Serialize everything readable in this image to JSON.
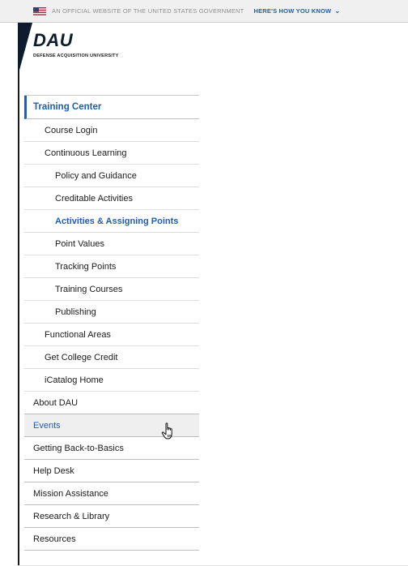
{
  "banner": {
    "official_text": "AN OFFICIAL WEBSITE OF THE UNITED STATES GOVERNMENT",
    "how_label": "HERE'S HOW YOU KNOW",
    "chevron": "⌄"
  },
  "logo": {
    "mark": "DAU",
    "subtitle": "DEFENSE ACQUISITION UNIVERSITY"
  },
  "nav": {
    "training_center": "Training Center",
    "course_login": "Course Login",
    "continuous_learning": "Continuous Learning",
    "policy_guidance": "Policy and Guidance",
    "creditable_activities": "Creditable Activities",
    "activities_points": "Activities & Assigning Points",
    "point_values": "Point Values",
    "tracking_points": "Tracking Points",
    "training_courses": "Training Courses",
    "publishing": "Publishing",
    "functional_areas": "Functional Areas",
    "college_credit": "Get College Credit",
    "icatalog_home": "iCatalog Home",
    "about_dau": "About DAU",
    "events": "Events",
    "back_to_basics": "Getting Back-to-Basics",
    "help_desk": "Help Desk",
    "mission_assistance": "Mission Assistance",
    "research_library": "Research & Library",
    "resources": "Resources"
  },
  "colors": {
    "accent": "#1f5fad",
    "banner_bg": "#f0f0f0",
    "hover_bg": "#efefef"
  },
  "icons": [
    "us-flag-icon",
    "chevron-down-icon",
    "hand-pointer-cursor-icon"
  ]
}
